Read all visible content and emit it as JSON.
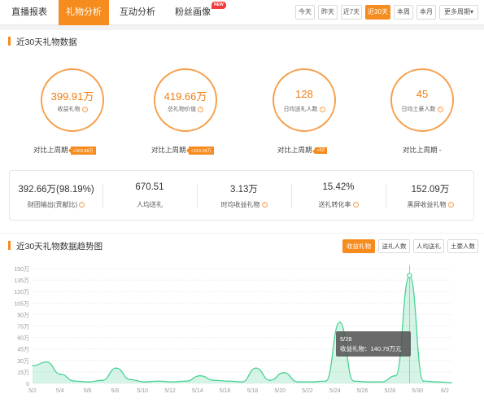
{
  "nav": {
    "tabs": [
      {
        "label": "直播报表"
      },
      {
        "label": "礼物分析"
      },
      {
        "label": "互动分析"
      },
      {
        "label": "粉丝画像"
      }
    ],
    "new_badge": "NEW",
    "periods": [
      "今天",
      "昨天",
      "近7天",
      "近30天",
      "本周",
      "本月",
      "更多周期"
    ],
    "more_periods_arrow": "▾"
  },
  "summary": {
    "title": "近30天礼物数据",
    "circles": [
      {
        "value": "399.91万",
        "label": "收益礼物",
        "compare_label": "对比上周期",
        "compare_badge": "+303.88万"
      },
      {
        "value": "419.66万",
        "label": "总礼物价值",
        "compare_label": "对比上周期",
        "compare_badge": "+310.28万"
      },
      {
        "value": "128",
        "label": "日均送礼人数",
        "compare_label": "对比上周期",
        "compare_badge": "+63"
      },
      {
        "value": "45",
        "label": "日均土豪人数",
        "compare_label": "对比上周期 -",
        "compare_badge": ""
      }
    ],
    "stats": [
      {
        "value": "392.66万(98.19%)",
        "label": "财团输出(贡献比)"
      },
      {
        "value": "670.51",
        "label": "人均送礼"
      },
      {
        "value": "3.13万",
        "label": "时均收益礼物"
      },
      {
        "value": "15.42%",
        "label": "送礼转化率"
      },
      {
        "value": "152.09万",
        "label": "黑屏收益礼物"
      }
    ]
  },
  "trend": {
    "title": "近30天礼物数据趋势图",
    "metric_buttons": [
      "收益礼物",
      "送礼人数",
      "人均送礼",
      "土豪人数"
    ],
    "active_metric": "收益礼物",
    "tooltip": {
      "date": "5/28",
      "text": "收益礼物：140.79万元"
    }
  },
  "colors": {
    "accent": "#f68c1e",
    "series": "#3ecf8e"
  },
  "chart_data": {
    "type": "area",
    "ytick_labels": [
      "0",
      "15万",
      "30万",
      "45万",
      "60万",
      "75万",
      "90万",
      "105万",
      "120万",
      "135万",
      "150万"
    ],
    "xtick_labels": [
      "5/2",
      "5/4",
      "5/6",
      "5/8",
      "5/10",
      "5/12",
      "5/14",
      "5/16",
      "5/18",
      "5/20",
      "5/22",
      "5/24",
      "5/26",
      "5/28",
      "5/30",
      "6/2"
    ],
    "ylim": [
      0,
      150
    ],
    "x": [
      "5/1",
      "5/2",
      "5/3",
      "5/4",
      "5/5",
      "5/6",
      "5/7",
      "5/8",
      "5/9",
      "5/10",
      "5/11",
      "5/12",
      "5/13",
      "5/14",
      "5/15",
      "5/16",
      "5/17",
      "5/18",
      "5/19",
      "5/20",
      "5/21",
      "5/22",
      "5/23",
      "5/24",
      "5/25",
      "5/26",
      "5/27",
      "5/28",
      "5/29",
      "5/30",
      "5/31"
    ],
    "series": [
      {
        "values": [
          23,
          28,
          12,
          3,
          2,
          4,
          20,
          5,
          2,
          3,
          2,
          3,
          10,
          4,
          3,
          2,
          20,
          4,
          14,
          2,
          2,
          3,
          80,
          3,
          2,
          2,
          10,
          141,
          3,
          2,
          1
        ]
      }
    ]
  }
}
